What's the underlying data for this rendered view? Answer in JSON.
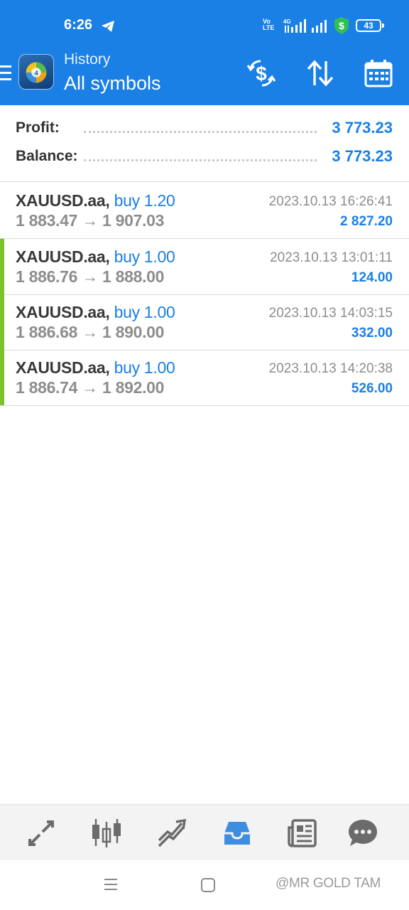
{
  "status_bar": {
    "time": "6:26",
    "volte": "Vo LTE",
    "network": "4G",
    "battery": "43",
    "icons": [
      "telegram-icon",
      "signal-icon",
      "shield-dollar-icon",
      "battery-icon"
    ]
  },
  "app_bar": {
    "title": "History",
    "subtitle": "All symbols",
    "icons": [
      "menu-icon",
      "app-logo",
      "currency-exchange-icon",
      "sort-icon",
      "calendar-icon"
    ]
  },
  "summary": {
    "profit_label": "Profit:",
    "profit_value": "3 773.23",
    "balance_label": "Balance:",
    "balance_value": "3 773.23"
  },
  "deals": [
    {
      "symbol": "XAUUSD.aa,",
      "side": "buy 1.20",
      "open_price": "1 883.47",
      "arrow": "→",
      "close_price": "1 907.03",
      "time": "2023.10.13 16:26:41",
      "profit": "2 827.20",
      "marker": false
    },
    {
      "symbol": "XAUUSD.aa,",
      "side": "buy 1.00",
      "open_price": "1 886.76",
      "arrow": "→",
      "close_price": "1 888.00",
      "time": "2023.10.13 13:01:11",
      "profit": "124.00",
      "marker": true
    },
    {
      "symbol": "XAUUSD.aa,",
      "side": "buy 1.00",
      "open_price": "1 886.68",
      "arrow": "→",
      "close_price": "1 890.00",
      "time": "2023.10.13 14:03:15",
      "profit": "332.00",
      "marker": true
    },
    {
      "symbol": "XAUUSD.aa,",
      "side": "buy 1.00",
      "open_price": "1 886.74",
      "arrow": "→",
      "close_price": "1 892.00",
      "time": "2023.10.13 14:20:38",
      "profit": "526.00",
      "marker": true
    }
  ],
  "bottom_nav": {
    "items": [
      "quotes-icon",
      "chart-icon",
      "trade-icon",
      "history-icon",
      "news-icon",
      "chat-icon"
    ],
    "active": "history-icon"
  },
  "system_nav": {
    "watermark": "@MR GOLD TAM"
  },
  "colors": {
    "accent": "#1a80e5",
    "marker": "#7cc22a",
    "icon_gray": "#6b6b6b"
  }
}
